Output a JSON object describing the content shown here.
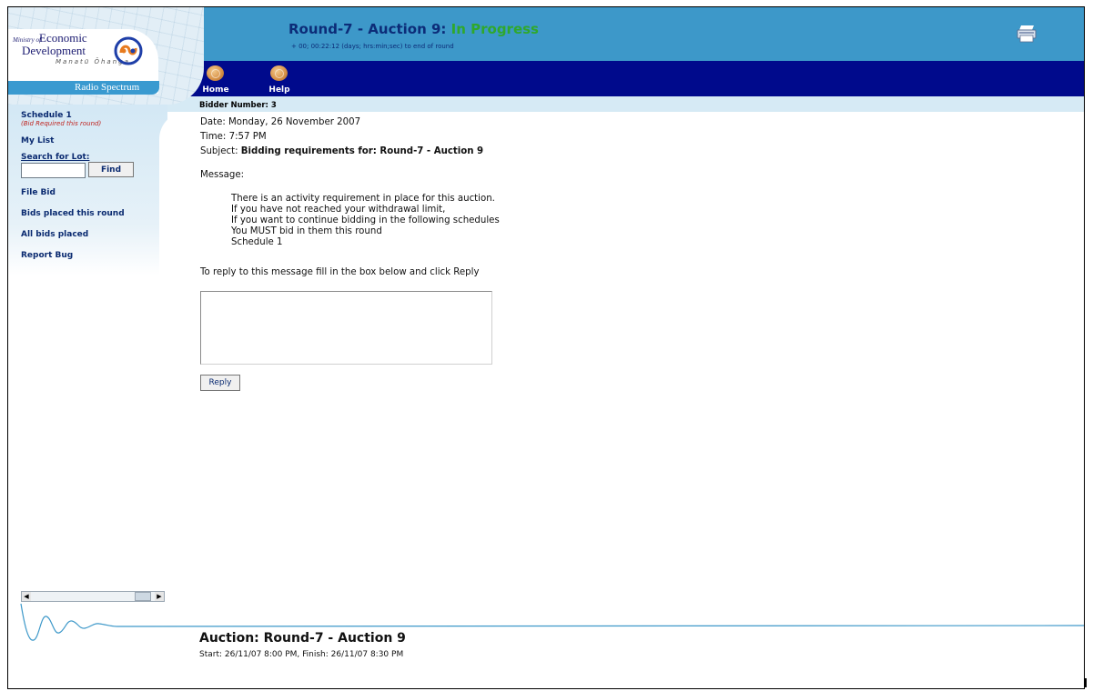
{
  "header": {
    "logo": {
      "ministry_text": "Ministry of",
      "economic_text": "Economic",
      "development_text": "Development",
      "maori_text": "Manatū Ōhanga",
      "radio_spectrum_text": "Radio Spectrum"
    },
    "title": "Round-7 - Auction 9: ",
    "status": "In Progress",
    "countdown": "+ 00; 00:22:12 (days; hrs:min;sec) to end of round",
    "print_icon": "printer-icon"
  },
  "nav": {
    "home_label": "Home",
    "help_label": "Help",
    "icon": "coin-icon"
  },
  "bidder_number": "Bidder Number: 3",
  "sidebar": {
    "schedule_label": "Schedule 1",
    "schedule_note": "(Bid Required this round)",
    "my_list": "My List",
    "search_label": "Search for Lot:",
    "search_value": "",
    "find_label": "Find",
    "file_bid": "File Bid",
    "bids_this_round": "Bids placed this round",
    "all_bids": "All bids placed",
    "report_bug": "Report Bug"
  },
  "message": {
    "date_label": "Date: Monday, 26 November 2007",
    "time_label": "Time: 7:57 PM",
    "subject_prefix": "Subject: ",
    "subject_text": "Bidding requirements for: Round-7 - Auction 9",
    "message_label": "Message:",
    "lines": [
      "There is an activity requirement in place for this auction.",
      "If you have not reached your withdrawal limit,",
      "If you want to continue bidding in the following schedules",
      "You MUST bid in them this round",
      "Schedule 1"
    ],
    "reply_instructions": "To reply to this message fill in the box below and click Reply",
    "reply_value": "",
    "reply_button": "Reply"
  },
  "footer": {
    "auction_title": "Auction: Round-7 - Auction 9",
    "times": "Start: 26/11/07 8:00 PM, Finish: 26/11/07 8:30 PM"
  },
  "colors": {
    "header_blue": "#3d98c9",
    "nav_blue": "#000a8c",
    "status_green": "#2fa82c",
    "title_navy": "#0c2c78"
  }
}
